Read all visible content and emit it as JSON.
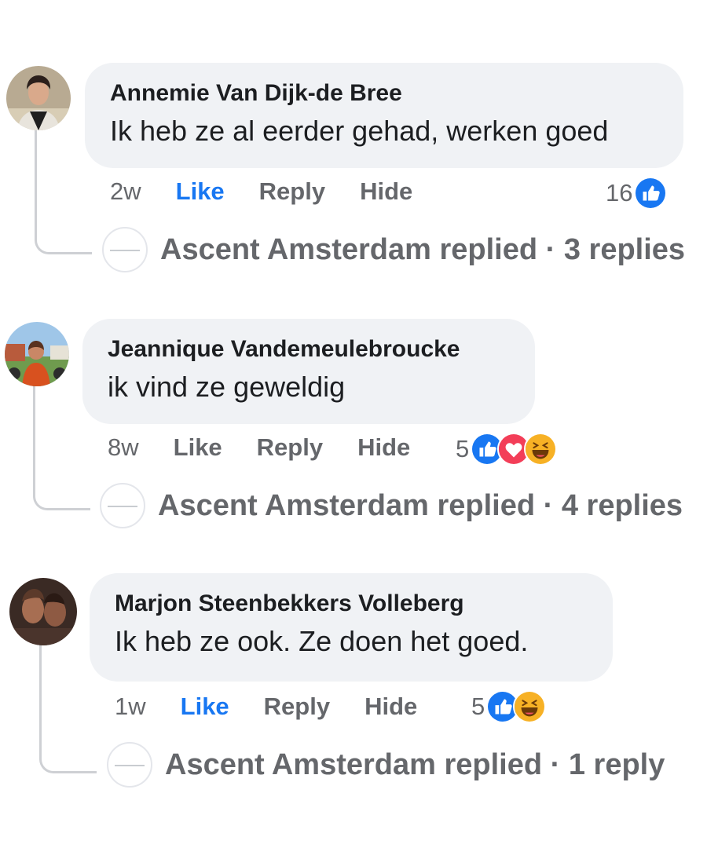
{
  "comments": [
    {
      "author": "Annemie Van Dijk-de Bree",
      "text": "Ik heb ze al eerder gehad, werken goed",
      "time": "2w",
      "like": "Like",
      "reply": "Reply",
      "hide": "Hide",
      "liked": true,
      "reaction_count": "16",
      "reactions": [
        "like-icon"
      ],
      "replies_summary": "Ascent Amsterdam replied · 3 replies"
    },
    {
      "author": "Jeannique Vandemeulebroucke",
      "text": "ik vind ze geweldig",
      "time": "8w",
      "like": "Like",
      "reply": "Reply",
      "hide": "Hide",
      "liked": false,
      "reaction_count": "5",
      "reactions": [
        "like-icon",
        "love-icon",
        "haha-icon"
      ],
      "replies_summary": "Ascent Amsterdam replied · 4 replies"
    },
    {
      "author": "Marjon Steenbekkers Volleberg",
      "text": "Ik heb ze ook. Ze doen het goed.",
      "time": "1w",
      "like": "Like",
      "reply": "Reply",
      "hide": "Hide",
      "liked": true,
      "reaction_count": "5",
      "reactions": [
        "like-icon",
        "haha-icon"
      ],
      "replies_summary": "Ascent Amsterdam replied · 1 reply"
    }
  ],
  "colors": {
    "liked": "#1877f2",
    "meta": "#65676b",
    "bubble": "#f0f2f5",
    "like_icon": "#1877f2",
    "love_icon": "#f33e58",
    "haha_icon": "#f7b125"
  }
}
